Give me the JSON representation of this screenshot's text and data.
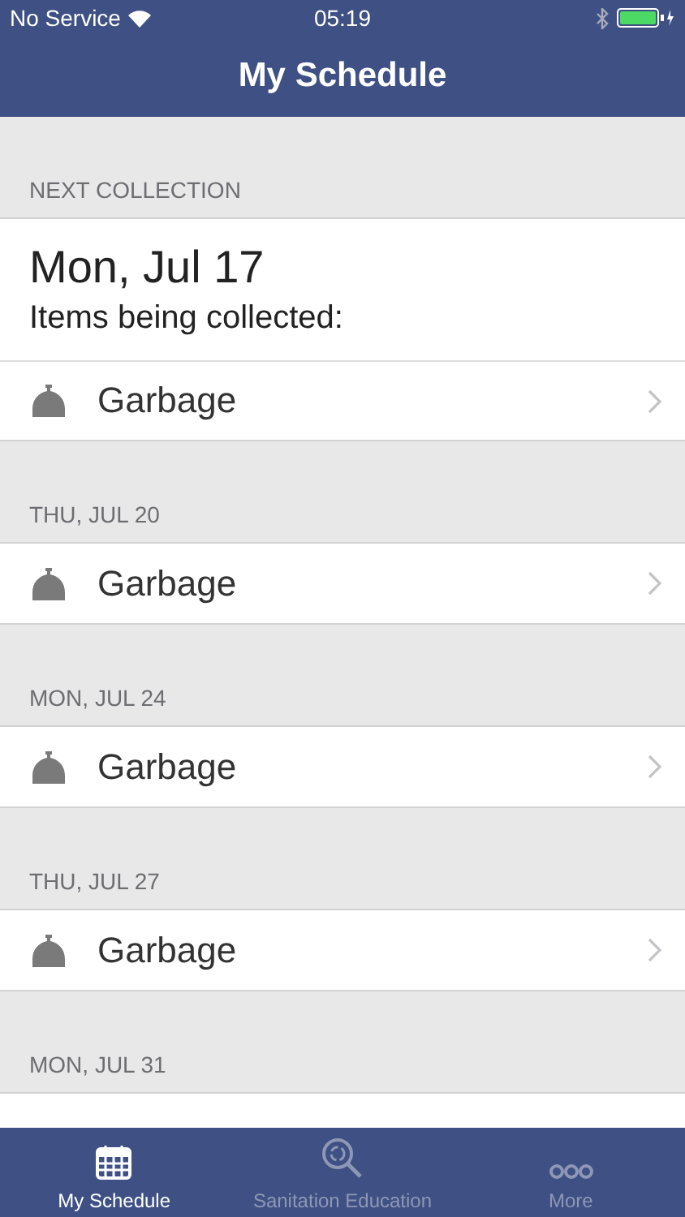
{
  "status_bar": {
    "carrier": "No Service",
    "time": "05:19"
  },
  "nav": {
    "title": "My Schedule"
  },
  "next_collection": {
    "header": "NEXT COLLECTION",
    "date": "Mon, Jul 17",
    "subtitle": "Items being collected:",
    "items": [
      {
        "label": "Garbage"
      }
    ]
  },
  "sections": [
    {
      "header": "THU, JUL 20",
      "items": [
        {
          "label": "Garbage"
        }
      ]
    },
    {
      "header": "MON, JUL 24",
      "items": [
        {
          "label": "Garbage"
        }
      ]
    },
    {
      "header": "THU, JUL 27",
      "items": [
        {
          "label": "Garbage"
        }
      ]
    },
    {
      "header": "MON, JUL 31"
    }
  ],
  "tabs": [
    {
      "label": "My Schedule",
      "kind": "calendar",
      "selected": true
    },
    {
      "label": "Sanitation Education",
      "kind": "search",
      "selected": false
    },
    {
      "label": "More",
      "kind": "more",
      "selected": false
    }
  ]
}
